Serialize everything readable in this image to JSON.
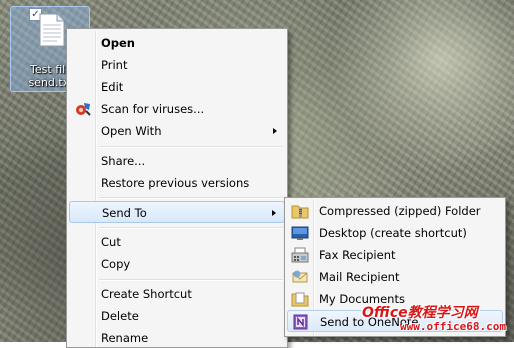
{
  "desktop": {
    "file": {
      "label_line1": "Test file",
      "label_line2": "send.txt",
      "checked": "✓"
    }
  },
  "context_menu": {
    "items": [
      {
        "label": "Open",
        "bold": true
      },
      {
        "label": "Print"
      },
      {
        "label": "Edit"
      },
      {
        "label": "Scan for viruses...",
        "icon": "antivirus-shield-icon"
      },
      {
        "label": "Open With",
        "submenu": true
      },
      {
        "label": "Share..."
      },
      {
        "label": "Restore previous versions"
      },
      {
        "label": "Send To",
        "submenu": true,
        "highlighted": true
      },
      {
        "label": "Cut"
      },
      {
        "label": "Copy"
      },
      {
        "label": "Create Shortcut"
      },
      {
        "label": "Delete"
      },
      {
        "label": "Rename"
      }
    ]
  },
  "sendto_menu": {
    "items": [
      {
        "label": "Compressed (zipped) Folder",
        "icon": "zip-folder-icon"
      },
      {
        "label": "Desktop (create shortcut)",
        "icon": "desktop-icon"
      },
      {
        "label": "Fax Recipient",
        "icon": "fax-icon"
      },
      {
        "label": "Mail Recipient",
        "icon": "mail-icon"
      },
      {
        "label": "My Documents",
        "icon": "documents-folder-icon"
      },
      {
        "label": "Send to OneNote",
        "icon": "onenote-icon",
        "highlighted": true
      }
    ]
  },
  "watermark": {
    "brand": "Office教程学习网",
    "url": "www.office68.com"
  },
  "colors": {
    "highlight_border": "#a8c8ec",
    "menu_bg": "#f5f5f5",
    "watermark": "#d81818"
  }
}
